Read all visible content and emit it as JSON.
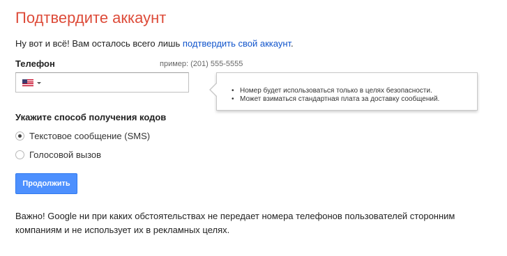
{
  "page": {
    "title": "Подтвердите аккаунт",
    "intro_text": "Ну вот и всё! Вам осталось всего лишь ",
    "intro_link": "подтвердить свой аккаунт",
    "intro_end": "."
  },
  "phone": {
    "label": "Телефон",
    "example": "пример: (201) 555-5555",
    "value": "",
    "country_icon": "us-flag-icon",
    "tooltip_items": [
      "Номер будет использоваться только в целях безопасности.",
      "Может взиматься стандартная плата за доставку сообщений."
    ],
    "tooltip_bullet": "•"
  },
  "method": {
    "heading": "Укажите способ получения кодов",
    "options": [
      {
        "label": "Текстовое сообщение (SMS)",
        "selected": true
      },
      {
        "label": "Голосовой вызов",
        "selected": false
      }
    ]
  },
  "actions": {
    "continue_label": "Продолжить"
  },
  "disclaimer": "Важно! Google ни при каких обстоятельствах не передает номера телефонов пользователей сторонним компаниям и не использует их в рекламных целях.",
  "colors": {
    "title": "#dd4b39",
    "link": "#1155cc",
    "button_bg": "#4d90fe",
    "button_border": "#3079ed"
  }
}
